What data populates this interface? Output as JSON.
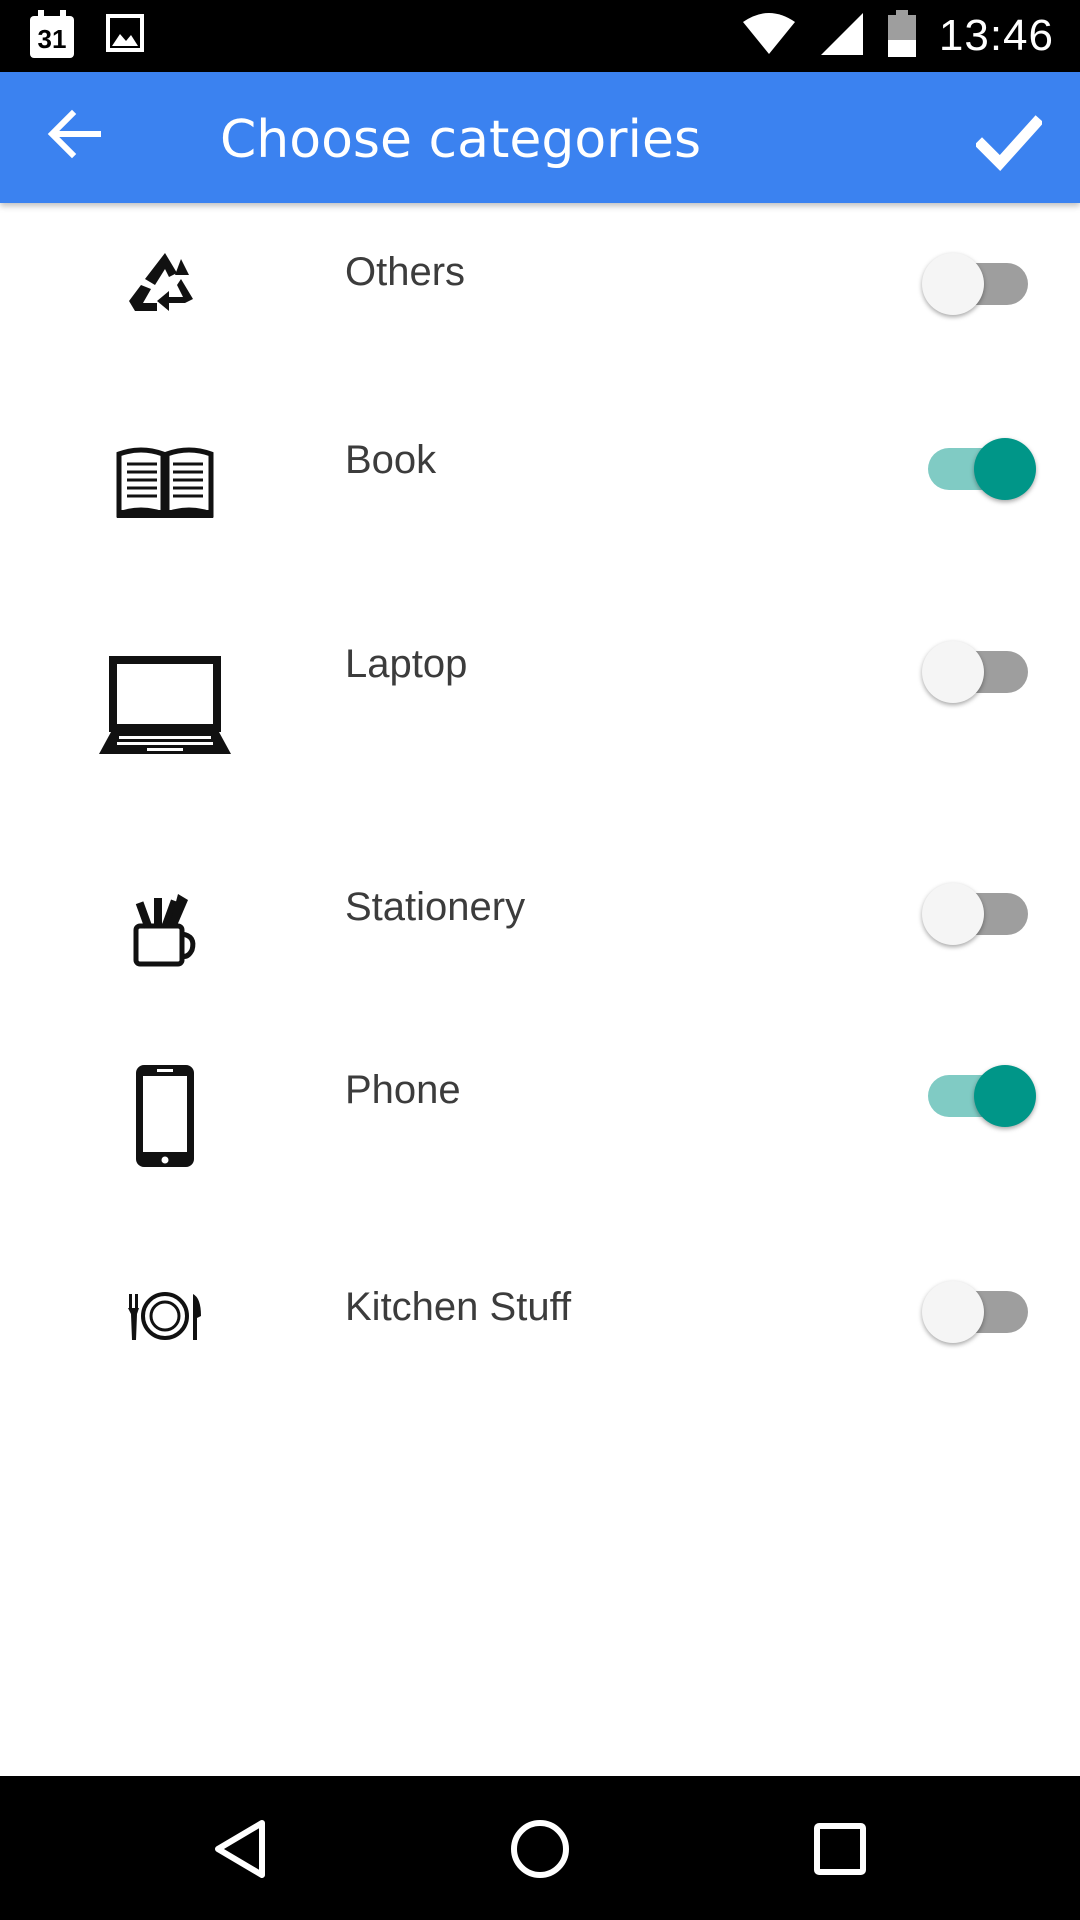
{
  "status_bar": {
    "time": "13:46",
    "calendar_day": "31",
    "icons": [
      "calendar-icon",
      "image-icon",
      "wifi-icon",
      "signal-icon",
      "battery-icon"
    ]
  },
  "app_bar": {
    "title": "Choose categories",
    "back_icon": "arrow-back-icon",
    "confirm_icon": "check-icon",
    "color": "#3b82f0"
  },
  "categories": [
    {
      "label": "Others",
      "icon": "recycle-icon",
      "enabled": false
    },
    {
      "label": "Book",
      "icon": "book-icon",
      "enabled": true
    },
    {
      "label": "Laptop",
      "icon": "laptop-icon",
      "enabled": false
    },
    {
      "label": "Stationery",
      "icon": "stationery-icon",
      "enabled": false
    },
    {
      "label": "Phone",
      "icon": "phone-icon",
      "enabled": true
    },
    {
      "label": "Kitchen Stuff",
      "icon": "kitchen-icon",
      "enabled": false
    }
  ],
  "switch_colors": {
    "on_thumb": "#009688",
    "on_track": "#80cbc4",
    "off_thumb": "#f5f5f5",
    "off_track": "#9e9e9e"
  },
  "nav_bar": {
    "icons": [
      "back-triangle-icon",
      "home-circle-icon",
      "recents-square-icon"
    ]
  }
}
